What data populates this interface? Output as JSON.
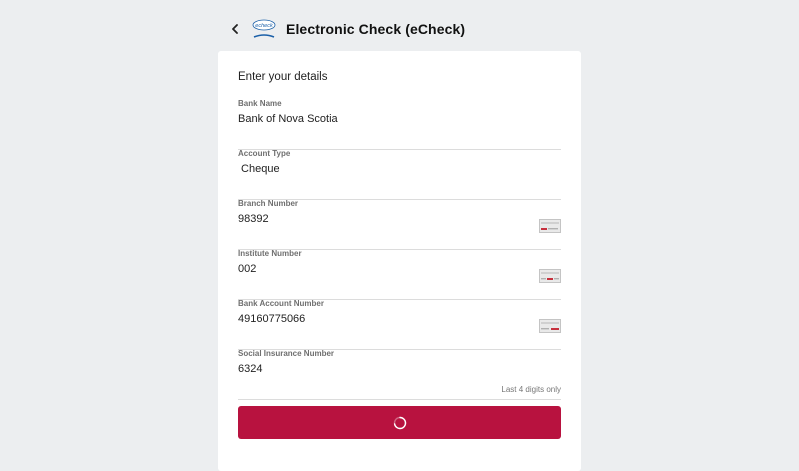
{
  "header": {
    "title": "Electronic Check (eCheck)",
    "logo_text": "echeck"
  },
  "form": {
    "section_title": "Enter your details",
    "fields": [
      {
        "label": "Bank Name",
        "value": "Bank of Nova Scotia",
        "icon": null
      },
      {
        "label": "Account Type",
        "value": " Cheque",
        "icon": null
      },
      {
        "label": "Branch Number",
        "value": "98392",
        "icon": "cheque-icon"
      },
      {
        "label": "Institute Number",
        "value": "002",
        "icon": "cheque-icon"
      },
      {
        "label": "Bank Account Number",
        "value": "49160775066",
        "icon": "cheque-icon"
      },
      {
        "label": "Social Insurance Number",
        "value": "6324",
        "icon": null
      }
    ],
    "sin_hint": "Last 4 digits only"
  },
  "submit": {
    "state": "loading",
    "icon": "spinner-icon"
  },
  "colors": {
    "background": "#eceef0",
    "card": "#ffffff",
    "accent": "#b8123f",
    "divider": "#dcdcdc"
  }
}
